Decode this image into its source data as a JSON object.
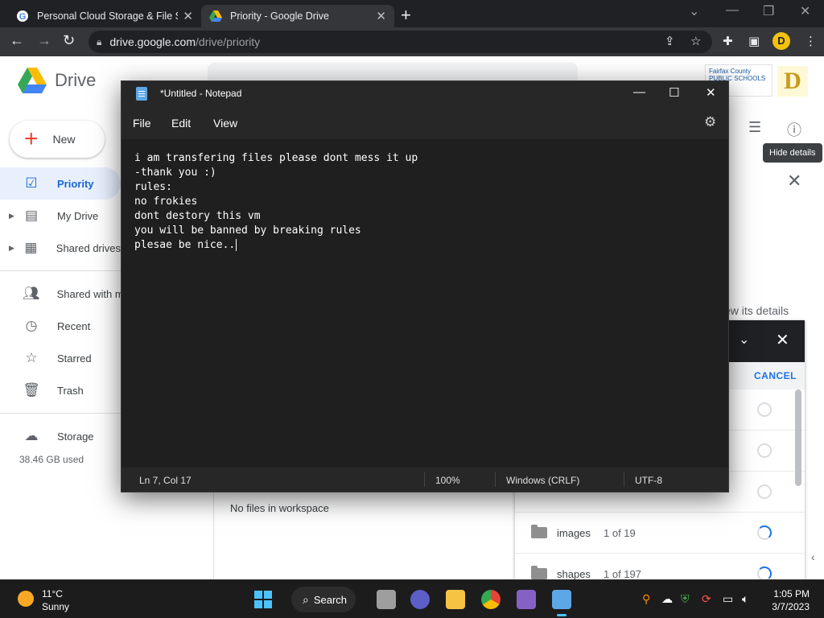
{
  "browser": {
    "tabs": [
      {
        "title": "Personal Cloud Storage & File Sh",
        "active": false
      },
      {
        "title": "Priority - Google Drive",
        "active": true
      }
    ],
    "url_host": "drive.google.com",
    "url_path": "/drive/priority",
    "profile_initial": "D"
  },
  "drive": {
    "app_name": "Drive",
    "new_label": "New",
    "nav": [
      {
        "label": "Priority",
        "icon": "priority-icon",
        "active": true
      },
      {
        "label": "My Drive",
        "icon": "my-drive-icon",
        "active": false
      },
      {
        "label": "Shared drives",
        "icon": "shared-drives-icon",
        "active": false
      },
      {
        "label": "Shared with m",
        "icon": "shared-with-me-icon",
        "active": false
      },
      {
        "label": "Recent",
        "icon": "recent-icon",
        "active": false
      },
      {
        "label": "Starred",
        "icon": "starred-icon",
        "active": false
      },
      {
        "label": "Trash",
        "icon": "trash-icon",
        "active": false
      },
      {
        "label": "Storage",
        "icon": "cloud-icon",
        "active": false
      }
    ],
    "storage_used": "38.46 GB used",
    "school_logo_text": "Fairfax County PUBLIC SCHOOLS",
    "d_logo": "D",
    "tooltip": "Hide details",
    "details_hint": "ew its details",
    "no_files": "No files in workspace",
    "upload_panel": {
      "cancel_label": "CANCEL",
      "rows": [
        {
          "name": "",
          "count": ""
        },
        {
          "name": "",
          "count": ""
        },
        {
          "name": "",
          "count": ""
        },
        {
          "name": "images",
          "count": "1 of 19"
        },
        {
          "name": "shapes",
          "count": "1 of 197"
        }
      ]
    }
  },
  "notepad": {
    "title": "*Untitled - Notepad",
    "menu": [
      "File",
      "Edit",
      "View"
    ],
    "lines": [
      "i am transfering files please dont mess it up",
      "-thank you :)",
      "rules:",
      "no frokies",
      "dont destory this vm",
      "you will be banned by breaking rules",
      "plesae be nice.."
    ],
    "status": {
      "position": "Ln 7, Col 17",
      "zoom": "100%",
      "line_ending": "Windows (CRLF)",
      "encoding": "UTF-8"
    }
  },
  "taskbar": {
    "temp": "11°C",
    "condition": "Sunny",
    "search_label": "Search",
    "time": "1:05 PM",
    "date": "3/7/2023"
  }
}
